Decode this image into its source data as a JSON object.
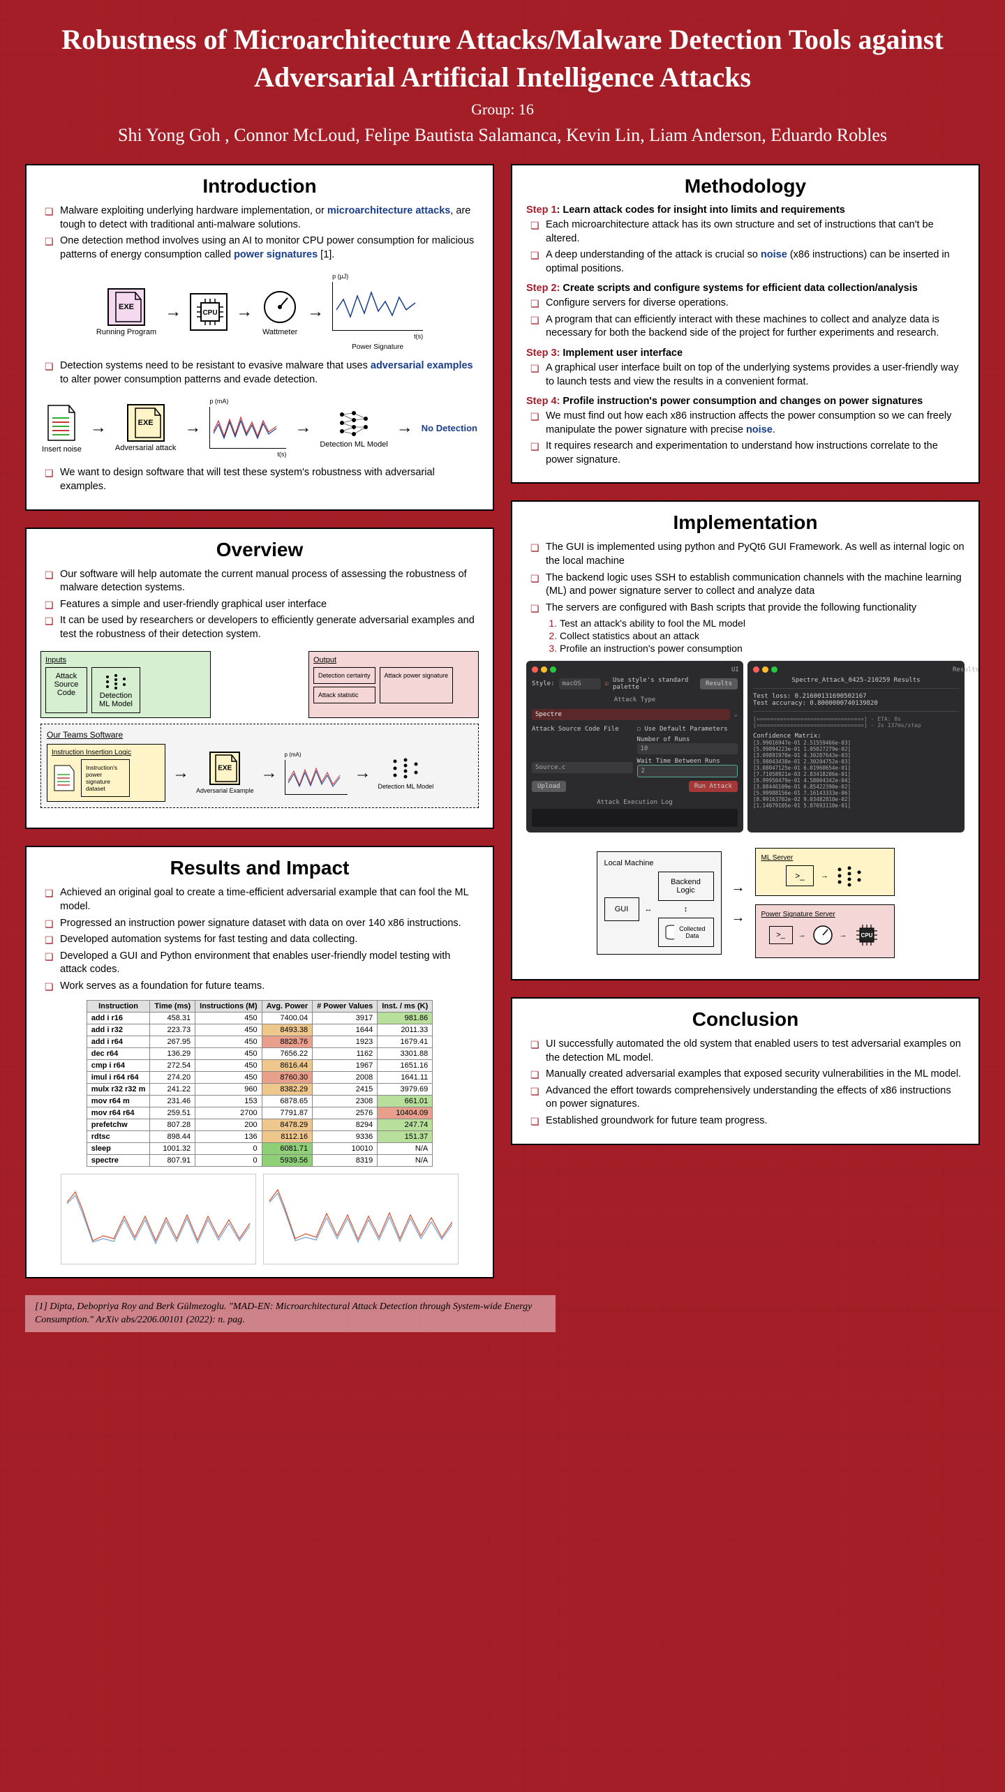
{
  "header": {
    "title": "Robustness of Microarchitecture Attacks/Malware Detection Tools against Adversarial Artificial Intelligence Attacks",
    "group": "Group: 16",
    "authors": "Shi Yong Goh , Connor McLoud, Felipe Bautista Salamanca, Kevin Lin, Liam Anderson, Eduardo Robles"
  },
  "intro": {
    "heading": "Introduction",
    "b1a": "Malware exploiting underlying hardware implementation, or ",
    "b1_term": "microarchitecture attacks",
    "b1b": ", are tough to detect with traditional anti-malware solutions.",
    "b2a": "One detection method involves using an AI to monitor CPU power consumption for malicious patterns of energy consumption called ",
    "b2_term": "power signatures",
    "b2b": " [1].",
    "diag1": {
      "exe": "EXE",
      "running": "Running Program",
      "cpu": "CPU",
      "watt": "Wattmeter",
      "yaxis": "p (µJ)",
      "xaxis": "t(s)",
      "sig": "Power Signature"
    },
    "b3a": "Detection systems need to be resistant to evasive malware that uses ",
    "b3_term": "adversarial examples",
    "b3b": " to alter power consumption patterns and evade detection.",
    "diag2": {
      "insert": "Insert noise",
      "exe": "EXE",
      "adv": "Adversarial attack",
      "yaxis": "p (mA)",
      "xaxis": "t(s)",
      "model": "Detection ML Model",
      "nodet": "No Detection"
    },
    "b4": "We want to design software that will test these system's robustness with adversarial examples."
  },
  "overview": {
    "heading": "Overview",
    "b1": "Our software will help automate the current manual process of assessing the robustness of malware detection systems.",
    "b2": "Features a simple and user-friendly graphical user interface",
    "b3": "It can be used by researchers or developers to efficiently generate adversarial examples and test the robustness of their detection system.",
    "diag": {
      "inputs": "Inputs",
      "attack_src": "Attack Source Code",
      "det_model": "Detection ML Model",
      "output": "Output",
      "det_cert": "Detection certainty",
      "atk_stat": "Attack statistic",
      "atk_pwr": "Attack power signature",
      "team": "Our Teams Software",
      "logic": "Instruction Insertion Logic",
      "dataset": "Instruction's power signature dataset",
      "exe": "EXE",
      "adv": "Adversarial Example",
      "yaxis": "p (mA)",
      "model2": "Detection ML Model"
    }
  },
  "results": {
    "heading": "Results and Impact",
    "b1": "Achieved an original goal to create a time-efficient adversarial example that can fool the ML model.",
    "b2": "Progressed an instruction power signature dataset with data on over 140 x86 instructions.",
    "b3": "Developed automation systems for fast testing and data collecting.",
    "b4": "Developed a GUI and Python environment that enables user-friendly model testing with attack codes.",
    "b5": "Work serves as a foundation for future teams.",
    "table": {
      "headers": [
        "Instruction",
        "Time (ms)",
        "Instructions (M)",
        "Avg. Power",
        "# Power Values",
        "Inst. / ms (K)"
      ],
      "rows": [
        [
          "add i r16",
          "458.31",
          "450",
          "7400.04",
          "3917",
          "981.86"
        ],
        [
          "add i r32",
          "223.73",
          "450",
          "8493.38",
          "1644",
          "2011.33"
        ],
        [
          "add i r64",
          "267.95",
          "450",
          "8828.76",
          "1923",
          "1679.41"
        ],
        [
          "dec r64",
          "136.29",
          "450",
          "7656.22",
          "1162",
          "3301.88"
        ],
        [
          "cmp i r64",
          "272.54",
          "450",
          "8616.44",
          "1967",
          "1651.16"
        ],
        [
          "imul i r64 r64",
          "274.20",
          "450",
          "8760.30",
          "2008",
          "1641.11"
        ],
        [
          "mulx r32 r32 m",
          "241.22",
          "960",
          "8382.29",
          "2415",
          "3979.69"
        ],
        [
          "mov r64 m",
          "231.46",
          "153",
          "6878.65",
          "2308",
          "661.01"
        ],
        [
          "mov r64 r64",
          "259.51",
          "2700",
          "7791.87",
          "2576",
          "10404.09"
        ],
        [
          "prefetchw",
          "807.28",
          "200",
          "8478.29",
          "8294",
          "247.74"
        ],
        [
          "rdtsc",
          "898.44",
          "136",
          "8112.16",
          "9336",
          "151.37"
        ],
        [
          "sleep",
          "1001.32",
          "0",
          "6081.71",
          "10010",
          "N/A"
        ],
        [
          "spectre",
          "807.91",
          "0",
          "5939.56",
          "8319",
          "N/A"
        ]
      ]
    }
  },
  "methodology": {
    "heading": "Methodology",
    "s1h_num": "Step 1",
    "s1h": ": Learn attack codes for insight into limits and requirements",
    "s1b1": "Each microarchitecture attack has its own structure and set of instructions that can't be altered.",
    "s1b2a": "A deep understanding of the attack is crucial so ",
    "s1b2term": "noise",
    "s1b2b": " (x86 instructions) can be inserted in optimal positions.",
    "s2h_num": "Step 2:",
    "s2h": " Create scripts and configure systems for efficient data collection/analysis",
    "s2b1": "Configure servers for diverse operations.",
    "s2b2": "A program that can efficiently interact with these machines to collect and analyze data is necessary for both the backend side of the project for further experiments and research.",
    "s3h_num": "Step 3:",
    "s3h": " Implement user interface",
    "s3b1": "A graphical user interface built on top of the underlying systems provides a user-friendly way to launch tests and view the results in a convenient format.",
    "s4h_num": "Step 4:",
    "s4h": " Profile instruction's power consumption and changes on power signatures",
    "s4b1a": "We must find out how each x86 instruction affects the power consumption so we can freely manipulate the power signature with precise ",
    "s4b1term": "noise",
    "s4b1b": ".",
    "s4b2": "It requires research and experimentation to understand how instructions correlate to the power signature."
  },
  "impl": {
    "heading": "Implementation",
    "b1": "The GUI is implemented using python and PyQt6 GUI Framework. As well as internal logic on the local machine",
    "b2": "The backend logic uses SSH to establish communication channels with the machine learning (ML) and power signature server to collect and analyze data",
    "b3": "The servers are configured with Bash scripts that provide the following functionality",
    "o1": "Test an attack's ability to fool the ML model",
    "o2": "Collect statistics about an attack",
    "o3": "Profile an instruction's power consumption",
    "gui": {
      "title1": "UI",
      "style_lbl": "Style:",
      "style_val": "macOS",
      "style_chk": "Use style's standard palette",
      "results_btn": "Results",
      "type_hdr": "Attack Type",
      "type_val": "Spectre",
      "src_lbl": "Attack Source Code File",
      "default_chk": "Use Default Parameters",
      "runs_lbl": "Number of Runs",
      "runs_val": "10",
      "source_lbl": "Source.c",
      "wait_lbl": "Wait Time Between Runs",
      "wait_val": "2",
      "upload_btn": "Upload",
      "run_btn": "Run Attack",
      "log_hdr": "Attack Execution Log",
      "title2": "Results",
      "res_name": "Spectre_Attack_0425-210259 Results",
      "loss": "Test loss: 0.21600131690502167",
      "acc": "Test accuracy: 0.8000000740139820",
      "bar1": "[================================] - ETA: 0s",
      "bar2": "[================================] - 2s 137ms/step",
      "matrix_hdr": "Confidence Matrix:",
      "matrix_vals": "[3.99016947e-01 2.51559466e-03]\n[5.99894223e-01 1.05027279e-02]\n[3.09891970e-01 4.30287643e-03]\n[5.98043438e-01 2.30204752e-03]\n[3.08047125e-01 6.01960654e-01]\n[7.71058921e-03 2.83418206e-01]\n[6.99950479e-01 4.58004342e-04]\n[3.08446109e-01 6.85422390e-02]\n[5.99988156e-01 7.16143333e-06]\n[8.99163702e-02 9.03482810e-02]\n[1.14079105e-01 5.87693110e-01]"
    },
    "arch": {
      "local": "Local Machine",
      "gui_box": "GUI",
      "backend": "Backend Logic",
      "collected": "Collected Data",
      "ml": "ML Server",
      "pwr": "Power Signature Server",
      "cpu": "CPU"
    }
  },
  "conclusion": {
    "heading": "Conclusion",
    "b1": "UI successfully automated the old system that enabled users to test adversarial examples on the detection ML model.",
    "b2": "Manually created adversarial examples that exposed security vulnerabilities in the ML model.",
    "b3": "Advanced the effort towards comprehensively understanding the effects of x86 instructions on power signatures.",
    "b4": "Established groundwork for future team progress."
  },
  "citation": "[1] Dipta, Debopriya Roy and Berk Gülmezoglu. \"MAD-EN: Microarchitectural Attack Detection through System-wide Energy Consumption.\" ArXiv abs/2206.00101 (2022): n. pag."
}
